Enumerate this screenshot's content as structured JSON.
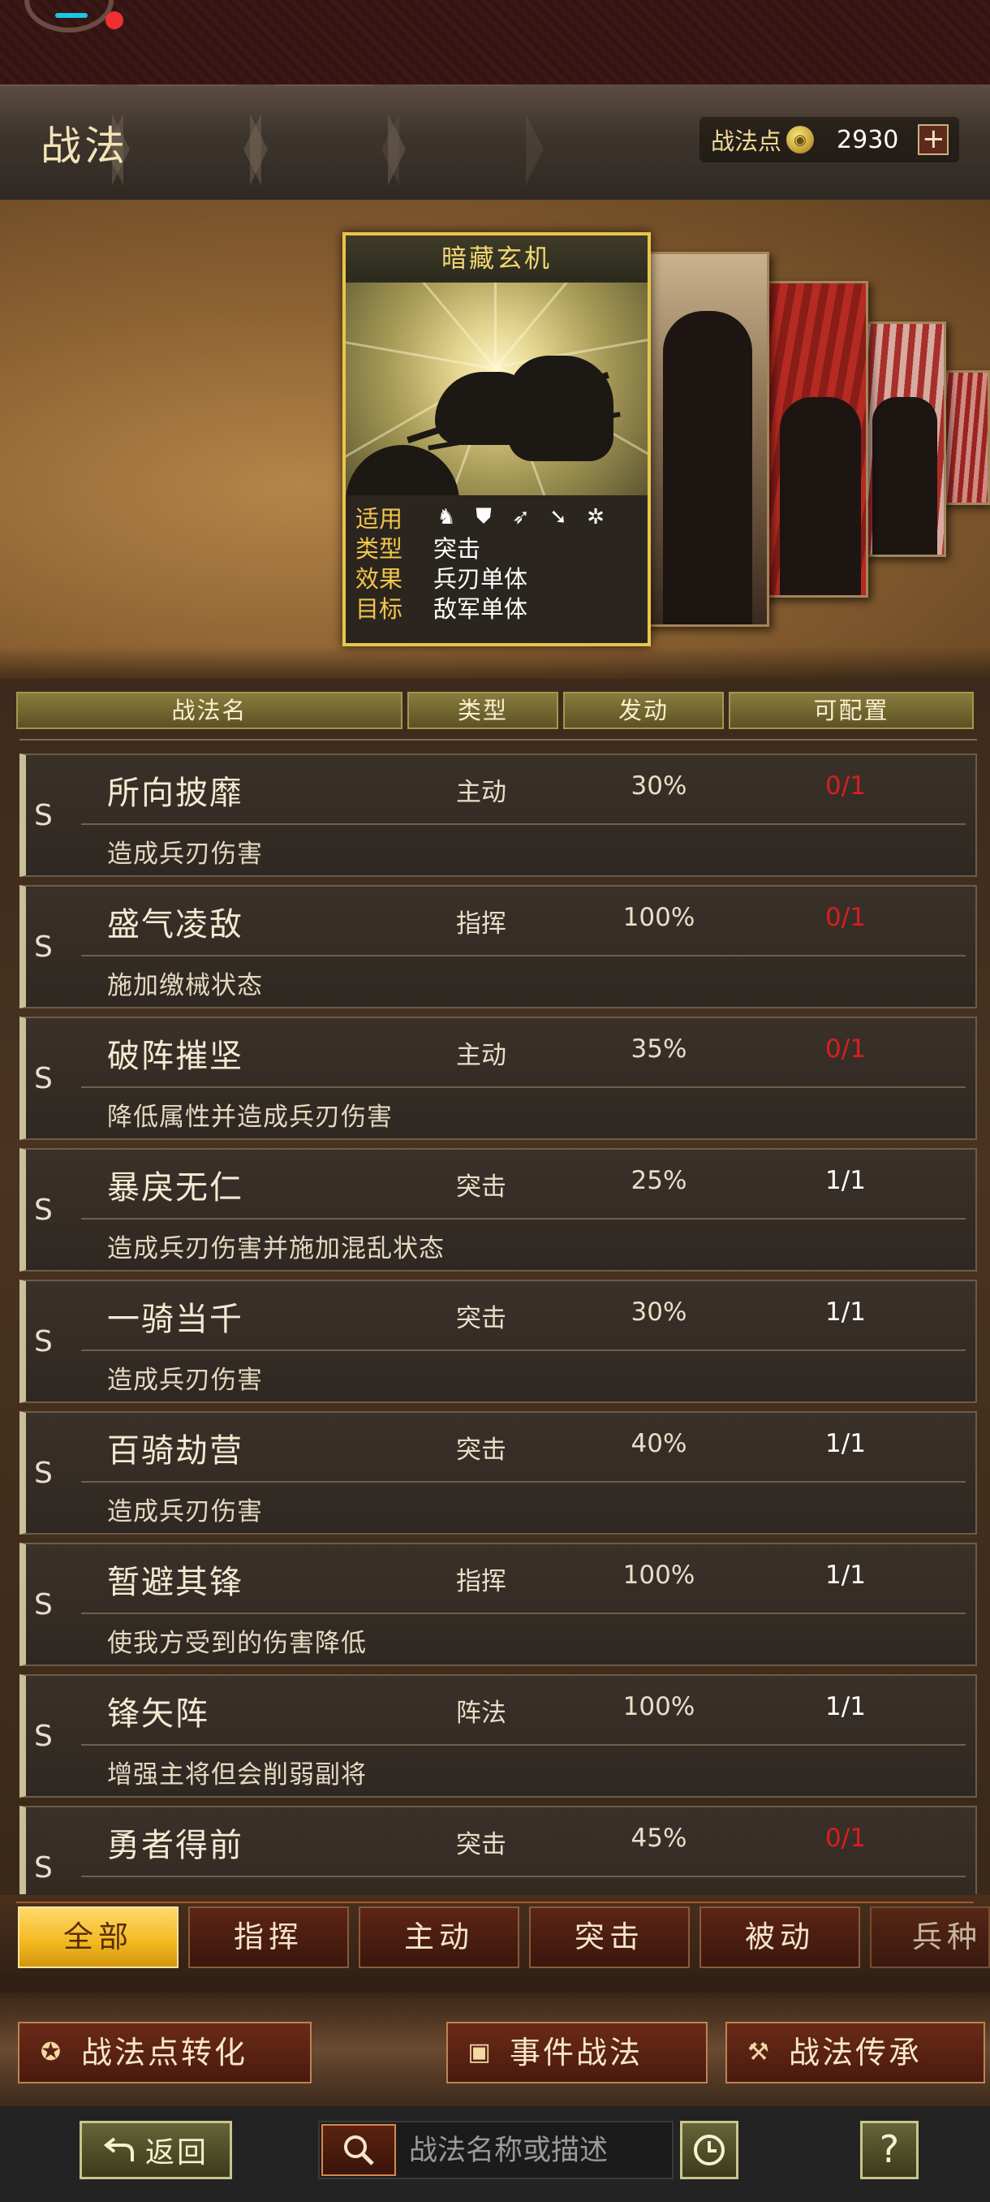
{
  "header": {
    "title": "战法",
    "points_label": "战法点",
    "points_value": "2930",
    "plus_label": "+"
  },
  "featured_card": {
    "name": "暗藏玄机",
    "labels": {
      "applies": "适用",
      "type": "类型",
      "effect": "效果",
      "target": "目标"
    },
    "type": "突击",
    "effect": "兵刃单体",
    "target": "敌军单体",
    "troop_icons": [
      "cavalry-icon",
      "shield-icon",
      "bow-icon",
      "spear-icon",
      "siege-wheel-icon"
    ]
  },
  "columns": {
    "name": "战法名",
    "type": "类型",
    "rate": "发动",
    "config": "可配置"
  },
  "tactics": [
    {
      "grade": "S",
      "name": "所向披靡",
      "type": "主动",
      "rate": "30%",
      "config": "0/1",
      "desc": "造成兵刃伤害"
    },
    {
      "grade": "S",
      "name": "盛气凌敌",
      "type": "指挥",
      "rate": "100%",
      "config": "0/1",
      "desc": "施加缴械状态"
    },
    {
      "grade": "S",
      "name": "破阵摧坚",
      "type": "主动",
      "rate": "35%",
      "config": "0/1",
      "desc": "降低属性并造成兵刃伤害"
    },
    {
      "grade": "S",
      "name": "暴戾无仁",
      "type": "突击",
      "rate": "25%",
      "config": "1/1",
      "desc": "造成兵刃伤害并施加混乱状态"
    },
    {
      "grade": "S",
      "name": "一骑当千",
      "type": "突击",
      "rate": "30%",
      "config": "1/1",
      "desc": "造成兵刃伤害"
    },
    {
      "grade": "S",
      "name": "百骑劫营",
      "type": "突击",
      "rate": "40%",
      "config": "1/1",
      "desc": "造成兵刃伤害"
    },
    {
      "grade": "S",
      "name": "暂避其锋",
      "type": "指挥",
      "rate": "100%",
      "config": "1/1",
      "desc": "使我方受到的伤害降低"
    },
    {
      "grade": "S",
      "name": "锋矢阵",
      "type": "阵法",
      "rate": "100%",
      "config": "1/1",
      "desc": "增强主将但会削弱副将"
    },
    {
      "grade": "S",
      "name": "勇者得前",
      "type": "突击",
      "rate": "45%",
      "config": "0/1",
      "desc": ""
    }
  ],
  "colors": {
    "config_unavailable": "#d71f1f",
    "config_available": "#ffffff",
    "active_tab": "#f2b81e"
  },
  "filter_tabs": [
    {
      "label": "全部",
      "active": true
    },
    {
      "label": "指挥",
      "active": false
    },
    {
      "label": "主动",
      "active": false
    },
    {
      "label": "突击",
      "active": false
    },
    {
      "label": "被动",
      "active": false
    },
    {
      "label": "兵种",
      "active": false
    }
  ],
  "actions": {
    "convert": "战法点转化",
    "event": "事件战法",
    "inherit": "战法传承"
  },
  "bottom": {
    "back": "返回",
    "search_placeholder": "战法名称或描述",
    "help": "?"
  }
}
